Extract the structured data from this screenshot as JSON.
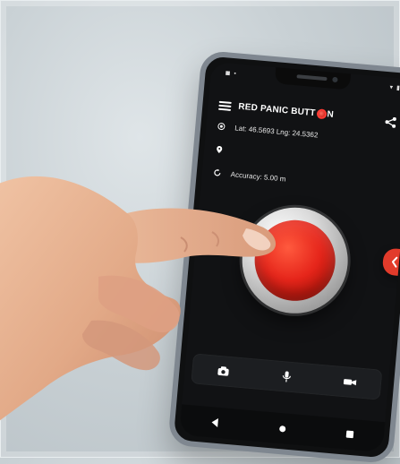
{
  "app": {
    "title_prefix": "RED PANIC BUTT",
    "title_suffix": "N",
    "location_text": "Lat: 46.5693 Lng: 24.5362",
    "accuracy_text": "Accuracy: 5.00 m"
  },
  "icons": {
    "menu": "menu-icon",
    "share": "share-icon",
    "crosshair": "crosshair-icon",
    "pin": "location-pin-icon",
    "refresh": "refresh-icon",
    "side_tab": "chevron-left-icon",
    "camera": "camera-icon",
    "mic": "microphone-icon",
    "video": "video-icon",
    "back": "back-icon",
    "home": "home-icon",
    "recent": "recent-apps-icon"
  },
  "colors": {
    "panic_red": "#e6261b",
    "tab_red": "#e23b2b",
    "screen_bg": "#111214"
  }
}
